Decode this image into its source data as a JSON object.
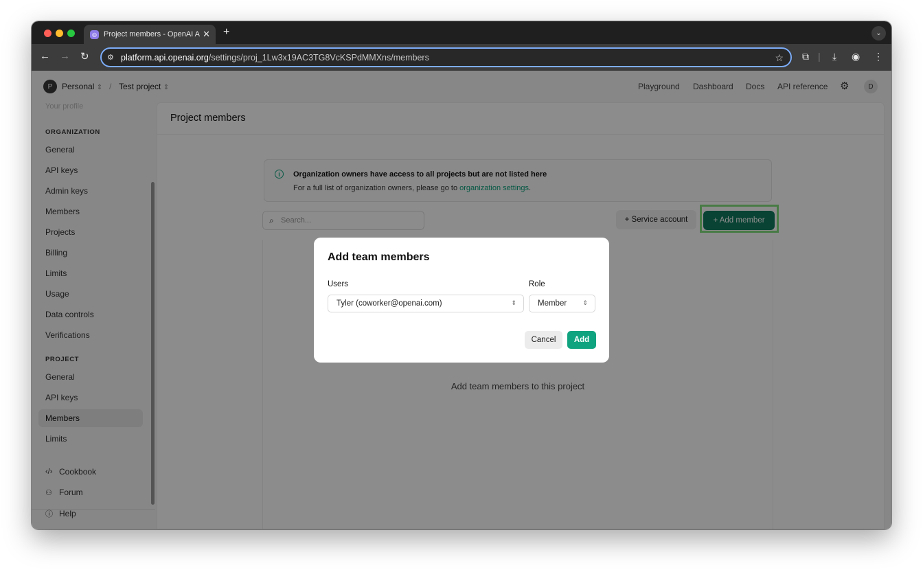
{
  "browser": {
    "tab_title": "Project members - OpenAI API",
    "tab_close": "✕",
    "new_tab": "+",
    "url_host": "platform.api.openai.org",
    "url_path": "/settings/proj_1Lw3x19AC3TG8VcKSPdMMXns/members"
  },
  "topnav": {
    "org_avatar": "P",
    "org_name": "Personal",
    "separator": "/",
    "project_name": "Test project",
    "links": [
      "Playground",
      "Dashboard",
      "Docs",
      "API reference"
    ],
    "user_avatar": "D"
  },
  "sidebar": {
    "faded_item": "Your profile",
    "org_heading": "ORGANIZATION",
    "org_items": [
      "General",
      "API keys",
      "Admin keys",
      "Members",
      "Projects",
      "Billing",
      "Limits",
      "Usage",
      "Data controls",
      "Verifications"
    ],
    "project_heading": "PROJECT",
    "project_items": [
      "General",
      "API keys",
      "Members",
      "Limits"
    ],
    "active_item": "Members",
    "footer": [
      {
        "icon": "code-icon",
        "label": "Cookbook"
      },
      {
        "icon": "people-icon",
        "label": "Forum"
      },
      {
        "icon": "help-icon",
        "label": "Help"
      }
    ]
  },
  "main": {
    "title": "Project members",
    "info_title": "Organization owners have access to all projects but are not listed here",
    "info_text": "For a full list of organization owners, please go to ",
    "info_link": "organization settings",
    "info_end": ".",
    "search_placeholder": "Search...",
    "service_account_label": "+ Service account",
    "add_member_label": "+ Add member",
    "empty_text": "Add team members to this project"
  },
  "modal": {
    "title": "Add team members",
    "users_label": "Users",
    "users_value": "Tyler (coworker@openai.com)",
    "role_label": "Role",
    "role_value": "Member",
    "cancel_label": "Cancel",
    "add_label": "Add"
  },
  "colors": {
    "accent": "#10a37f",
    "highlight": "#84e07f"
  }
}
